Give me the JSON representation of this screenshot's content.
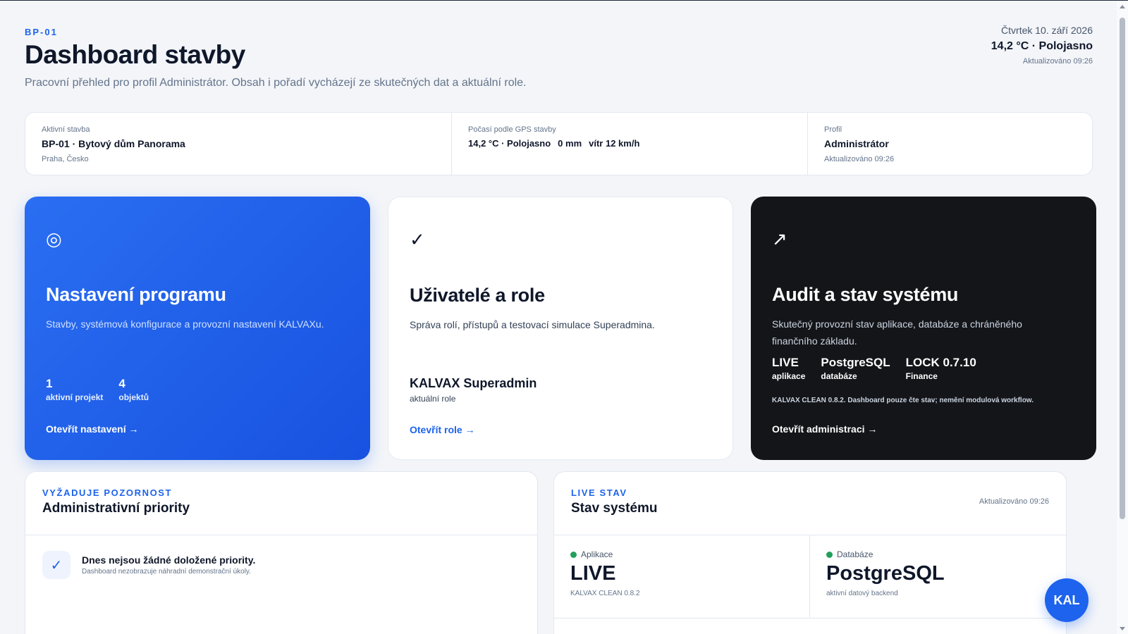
{
  "header": {
    "eyebrow": "BP-01",
    "title": "Dashboard stavby",
    "subtitle": "Pracovní přehled pro profil Administrátor. Obsah i pořadí vycházejí ze skutečných dat a aktuální role.",
    "date": "Čtvrtek 10. září 2026",
    "weather": "14,2 °C · Polojasno",
    "updated": "Aktualizováno 09:26"
  },
  "infobar": {
    "project": {
      "label": "Aktivní stavba",
      "value": "BP-01 · Bytový dům Panorama",
      "sub": "Praha, Česko"
    },
    "weather": {
      "label": "Počasí podle GPS stavby",
      "temp": "14,2 °C · Polojasno",
      "rain": "0 mm",
      "wind": "vítr 12 km/h"
    },
    "profile": {
      "label": "Profil",
      "value": "Administrátor",
      "sub": "Aktualizováno 09:26"
    }
  },
  "cards": {
    "settings": {
      "icon": "target-icon",
      "icon_glyph": "◎",
      "title": "Nastavení programu",
      "desc": "Stavby, systémová konfigurace a provozní nastavení KALVAXu.",
      "stats": [
        {
          "num": "1",
          "label": "aktivní projekt"
        },
        {
          "num": "4",
          "label": "objektů"
        }
      ],
      "link": "Otevřít nastavení →"
    },
    "roles": {
      "icon": "checkmark-icon",
      "icon_glyph": "✓",
      "title": "Uživatelé a role",
      "desc": "Správa rolí, přístupů a testovací simulace Superadmina.",
      "role_name": "KALVAX Superadmin",
      "role_sub": "aktuální role",
      "link": "Otevřít role →"
    },
    "audit": {
      "icon": "arrow-up-right-icon",
      "icon_glyph": "↗",
      "title": "Audit a stav systému",
      "desc": "Skutečný provozní stav aplikace, databáze a chráněného finančního základu.",
      "stats": [
        {
          "num": "LIVE",
          "label": "aplikace"
        },
        {
          "num": "PostgreSQL",
          "label": "databáze"
        },
        {
          "num": "LOCK 0.7.10",
          "label": "Finance"
        }
      ],
      "note": "KALVAX CLEAN 0.8.2. Dashboard pouze čte stav; nemění modulová workflow.",
      "link": "Otevřít administraci →"
    }
  },
  "priorities": {
    "eyebrow": "VYŽADUJE POZORNOST",
    "title": "Administrativní priority",
    "item_title": "Dnes nejsou žádné doložené priority.",
    "item_sub": "Dashboard nezobrazuje náhradní demonstrační úkoly."
  },
  "system": {
    "eyebrow": "LIVE STAV",
    "title": "Stav systému",
    "updated": "Aktualizováno 09:26",
    "cells": [
      {
        "label": "Aplikace",
        "value": "LIVE",
        "sub": "KALVAX CLEAN 0.8.2"
      },
      {
        "label": "Databáze",
        "value": "PostgreSQL",
        "sub": "aktivní datový backend"
      }
    ]
  },
  "fab": {
    "label": "KAL"
  },
  "colors": {
    "accent": "#1d63ed",
    "dark_card": "#141519",
    "status_ok": "#22a05a"
  }
}
